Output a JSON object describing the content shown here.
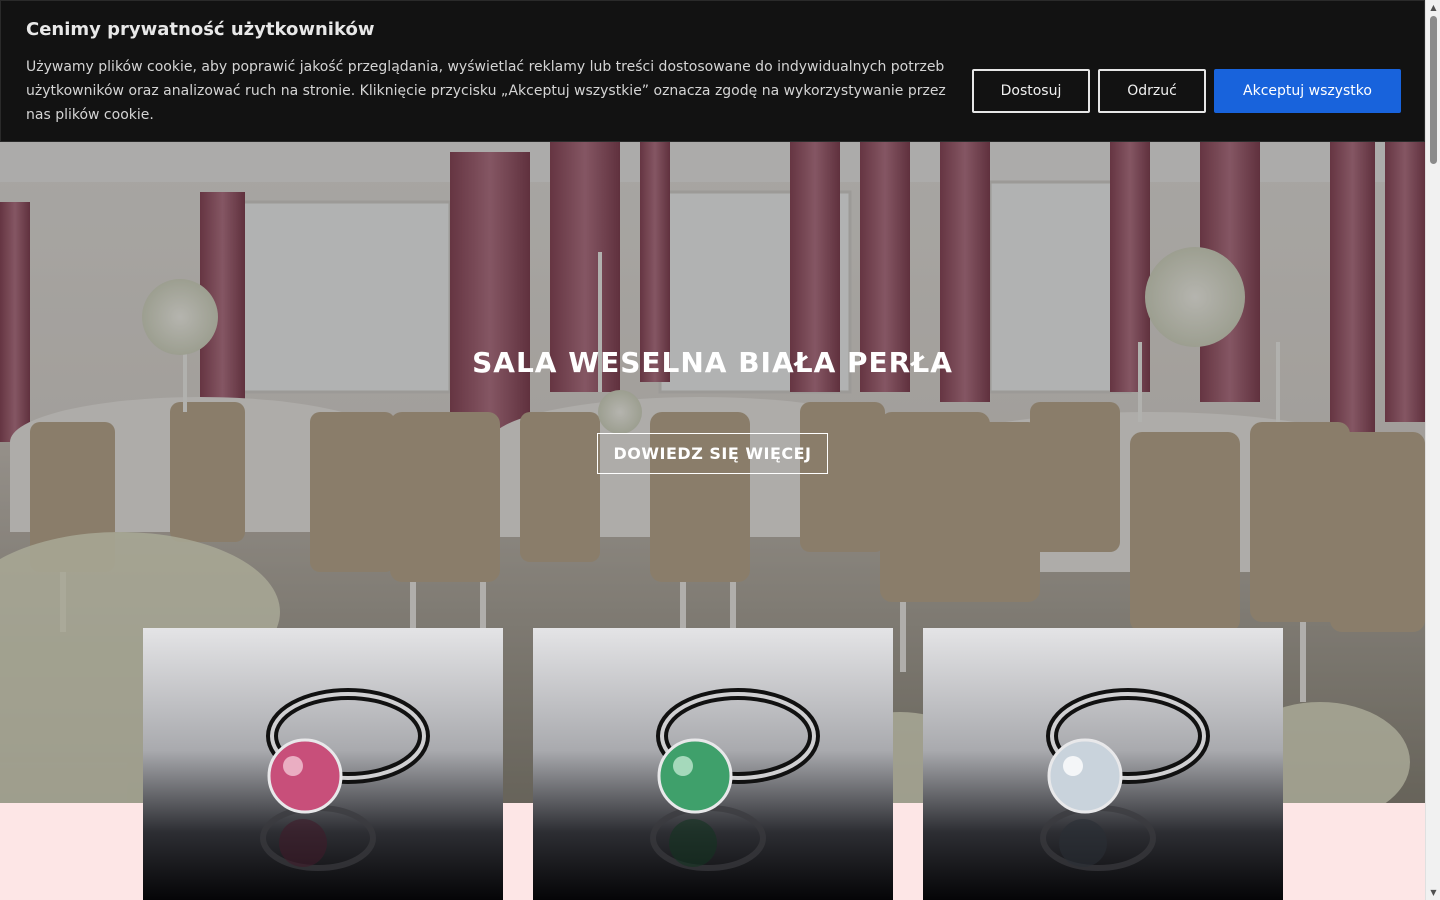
{
  "cookie_banner": {
    "title": "Cenimy prywatność użytkowników",
    "text": "Używamy plików cookie, aby poprawić jakość przeglądania, wyświetlać reklamy lub treści dostosowane do indywidualnych potrzeb użytkowników oraz analizować ruch na stronie. Kliknięcie przycisku „Akceptuj wszystkie” oznacza zgodę na wykorzystywanie przez nas plików cookie.",
    "customize_label": "Dostosuj",
    "reject_label": "Odrzuć",
    "accept_label": "Akceptuj wszystko",
    "accept_color": "#1863dc"
  },
  "hero": {
    "title": "SALA WESELNA BIAŁA PERŁA",
    "cta_label": "DOWIEDZ SIĘ WIĘCEJ"
  },
  "products": [
    {
      "image": "ring-pink-gem",
      "gem_color": "#c84f7a"
    },
    {
      "image": "ring-green-gem",
      "gem_color": "#3fa06b"
    },
    {
      "image": "ring-white-gem",
      "gem_color": "#c9d3dc"
    }
  ],
  "colors": {
    "banner_bg": "#121212",
    "section_bg": "#fde6e6"
  },
  "icons": {
    "scroll_up": "▲",
    "scroll_down": "▼"
  }
}
